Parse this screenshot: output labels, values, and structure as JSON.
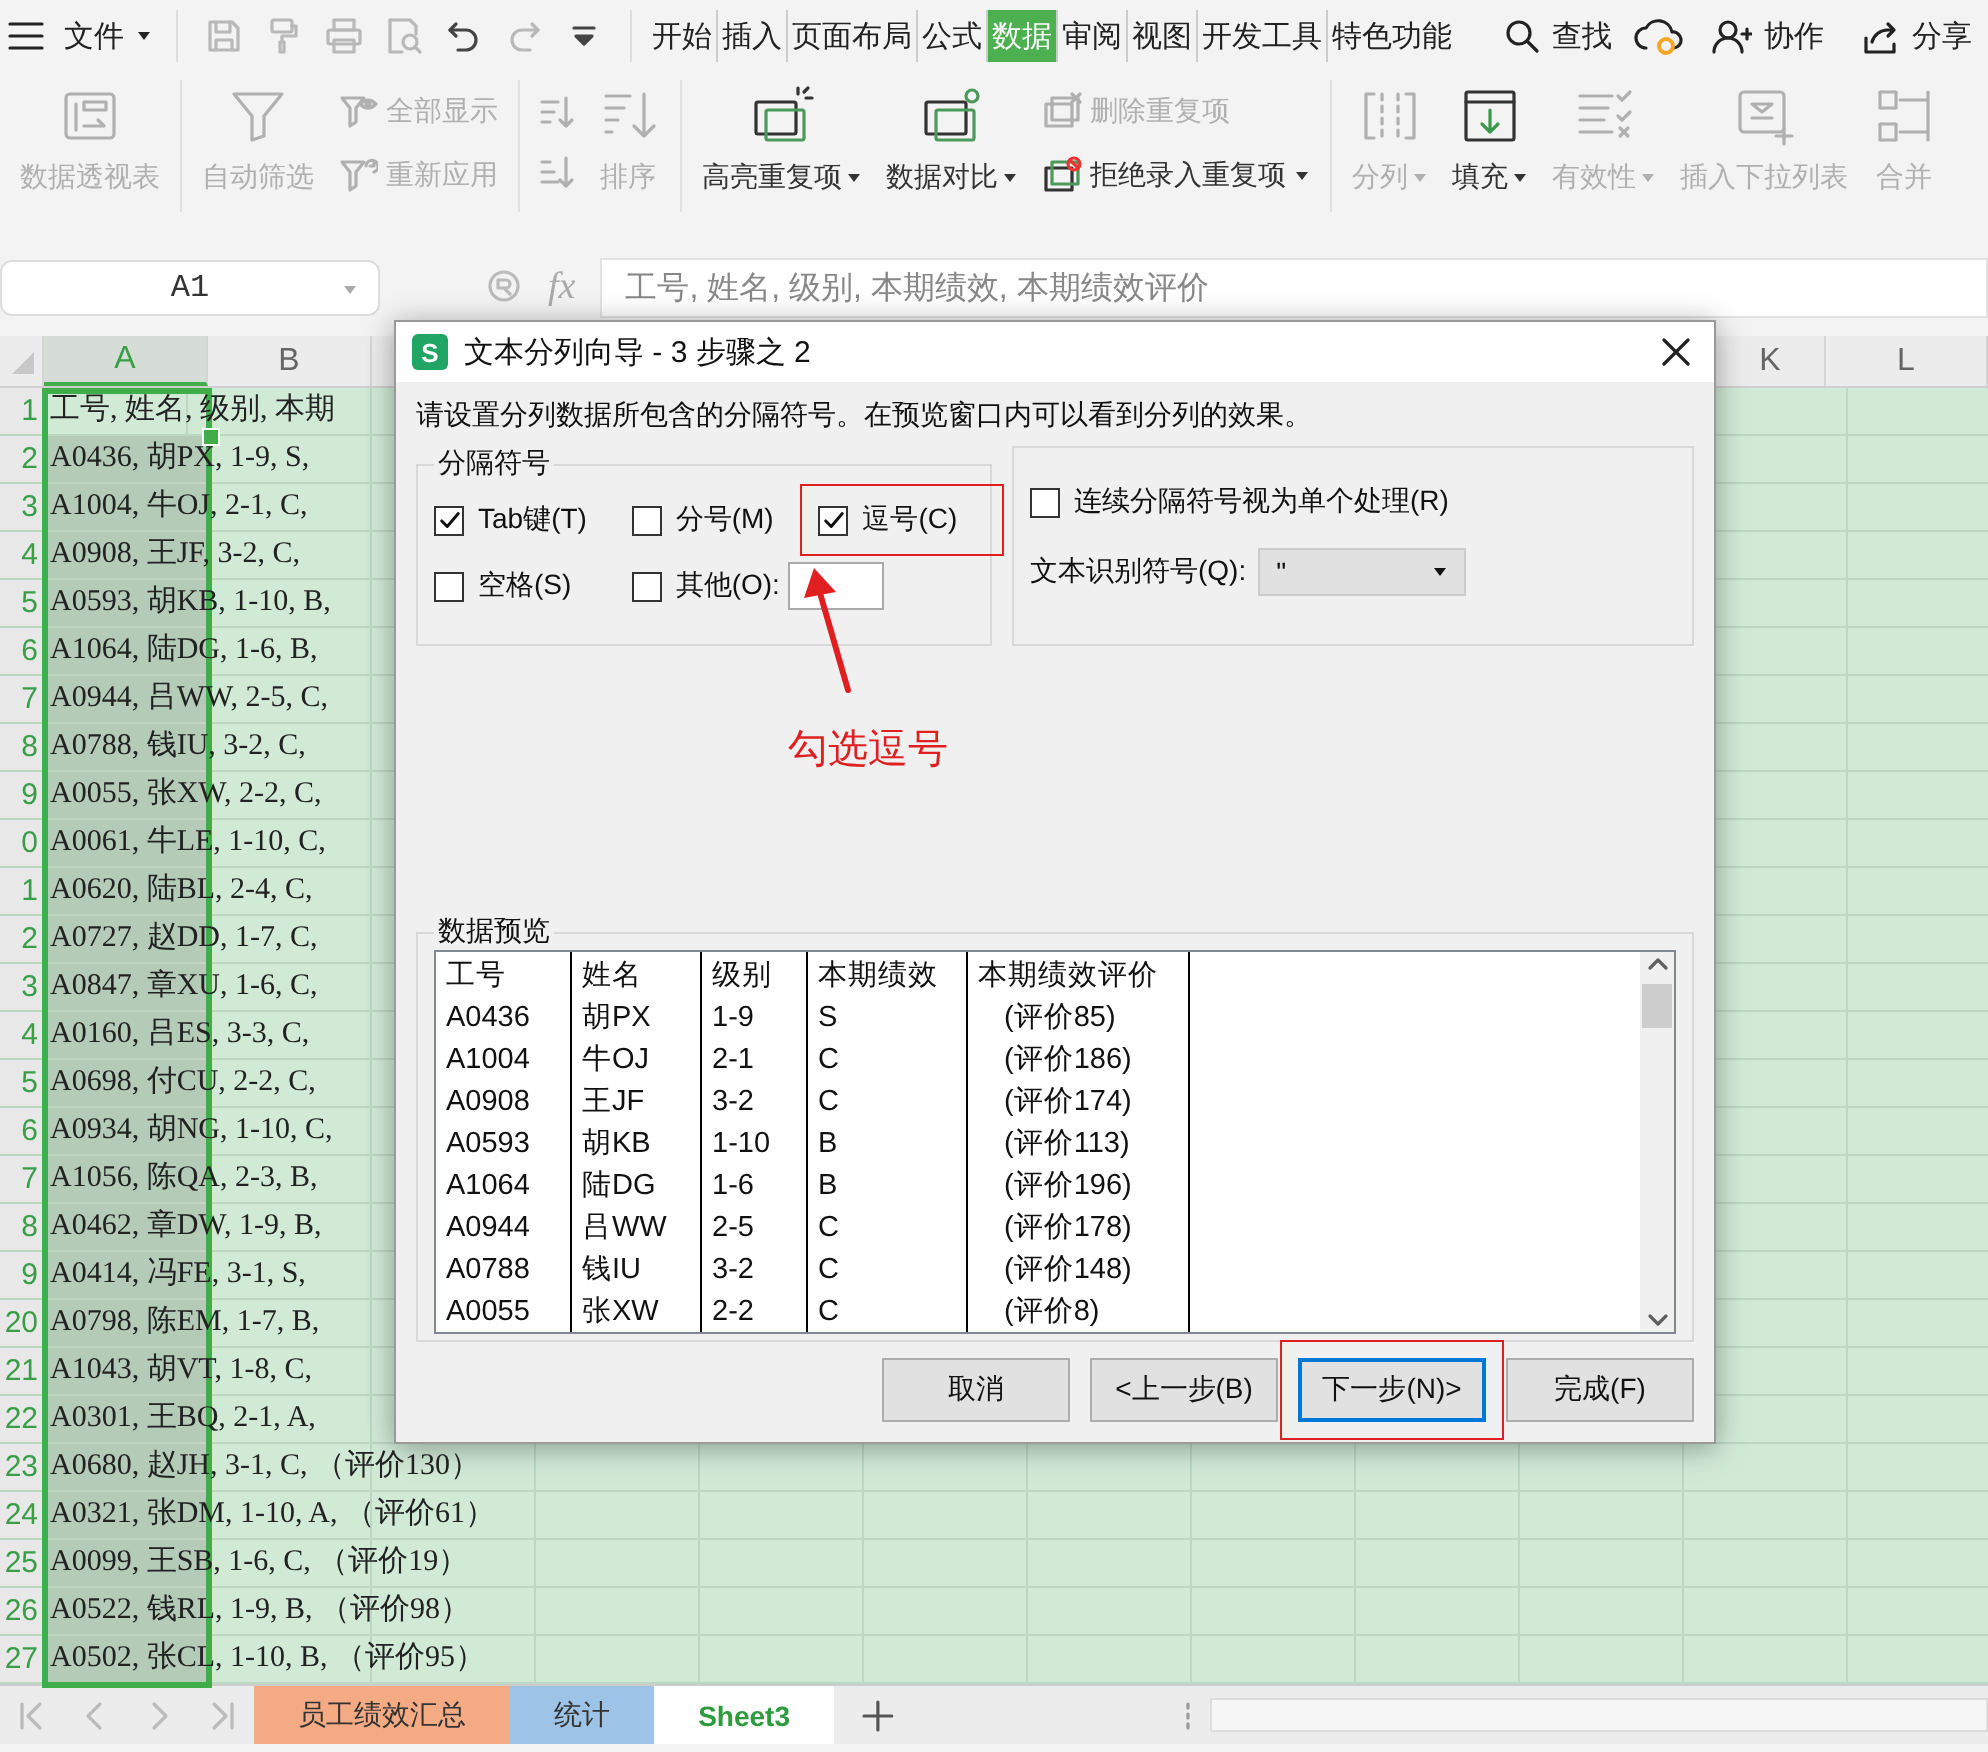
{
  "file_menu": {
    "label": "文件"
  },
  "quick_access": [
    {
      "disabled": true
    },
    {
      "disabled": true
    },
    {
      "disabled": true
    },
    {
      "disabled": true
    },
    {
      "disabled": false
    },
    {
      "disabled": true
    },
    {
      "disabled": false
    }
  ],
  "tabs": [
    {
      "label": "开始",
      "selected": false
    },
    {
      "label": "插入",
      "selected": false
    },
    {
      "label": "页面布局",
      "selected": false
    },
    {
      "label": "公式",
      "selected": false
    },
    {
      "label": "数据",
      "selected": true
    },
    {
      "label": "审阅",
      "selected": false
    },
    {
      "label": "视图",
      "selected": false
    },
    {
      "label": "开发工具",
      "selected": false
    },
    {
      "label": "特色功能",
      "selected": false
    }
  ],
  "search": {
    "label": "查找"
  },
  "actions": [
    {
      "label": "协作"
    },
    {
      "label": "分享"
    }
  ],
  "ribbon_groups": [
    [
      {
        "kind": "large",
        "label": "数据透视表",
        "disabled": true,
        "dropdown": false
      }
    ],
    [
      {
        "kind": "large",
        "label": "自动筛选",
        "disabled": true,
        "dropdown": false
      },
      {
        "kind": "stack",
        "items": [
          {
            "label": "全部显示",
            "disabled": true,
            "dropdown": false
          },
          {
            "label": "重新应用",
            "disabled": true,
            "dropdown": false
          }
        ]
      }
    ],
    [
      {
        "kind": "icons",
        "disabled": true
      },
      {
        "kind": "large",
        "label": "排序",
        "disabled": true,
        "dropdown": false
      }
    ],
    [
      {
        "kind": "large",
        "label": "高亮重复项",
        "disabled": false,
        "dropdown": true
      },
      {
        "kind": "large",
        "label": "数据对比",
        "disabled": false,
        "dropdown": true
      },
      {
        "kind": "stack",
        "items": [
          {
            "label": "删除重复项",
            "disabled": true,
            "dropdown": false
          },
          {
            "label": "拒绝录入重复项",
            "disabled": false,
            "dropdown": true
          }
        ]
      }
    ],
    [
      {
        "kind": "large",
        "label": "分列",
        "disabled": true,
        "dropdown": true
      },
      {
        "kind": "large",
        "label": "填充",
        "disabled": false,
        "dropdown": true
      },
      {
        "kind": "large",
        "label": "有效性",
        "disabled": true,
        "dropdown": true
      },
      {
        "kind": "large",
        "label": "插入下拉列表",
        "disabled": true,
        "dropdown": false
      },
      {
        "kind": "large",
        "label": "合并",
        "disabled": true,
        "dropdown": false
      }
    ]
  ],
  "formula_bar": {
    "cell": "A1",
    "fx": "fx",
    "formula": "工号, 姓名, 级别, 本期绩效, 本期绩效评价"
  },
  "sheet": {
    "left_columns": [
      {
        "label": "A",
        "selected": true
      },
      {
        "label": "B",
        "selected": false
      }
    ],
    "right_columns": [
      {
        "label": "K",
        "selected": false
      },
      {
        "label": "L",
        "selected": false
      }
    ],
    "rows": [
      {
        "number": "1",
        "text": "工号, 姓名, 级别, 本期"
      },
      {
        "number": "2",
        "text": "A0436, 胡PX, 1-9, S,"
      },
      {
        "number": "3",
        "text": "A1004, 牛OJ, 2-1, C,"
      },
      {
        "number": "4",
        "text": "A0908, 王JF, 3-2, C,"
      },
      {
        "number": "5",
        "text": "A0593, 胡KB, 1-10, B,"
      },
      {
        "number": "6",
        "text": "A1064, 陆DG, 1-6, B,"
      },
      {
        "number": "7",
        "text": "A0944, 吕WW, 2-5, C,"
      },
      {
        "number": "8",
        "text": "A0788, 钱IU, 3-2, C,"
      },
      {
        "number": "9",
        "text": "A0055, 张XW, 2-2, C,"
      },
      {
        "number": "0",
        "text": "A0061, 牛LE, 1-10, C,"
      },
      {
        "number": "1",
        "text": "A0620, 陆BL, 2-4, C,"
      },
      {
        "number": "2",
        "text": "A0727, 赵DD, 1-7, C,"
      },
      {
        "number": "3",
        "text": "A0847, 章XU, 1-6, C,"
      },
      {
        "number": "4",
        "text": "A0160, 吕ES, 3-3, C,"
      },
      {
        "number": "5",
        "text": "A0698, 付CU, 2-2, C,"
      },
      {
        "number": "6",
        "text": "A0934, 胡NG, 1-10, C,"
      },
      {
        "number": "7",
        "text": "A1056, 陈QA, 2-3, B,"
      },
      {
        "number": "8",
        "text": "A0462, 章DW, 1-9, B,"
      },
      {
        "number": "9",
        "text": "A0414, 冯FE, 3-1, S,"
      },
      {
        "number": "20",
        "text": "A0798, 陈EM, 1-7, B,"
      },
      {
        "number": "21",
        "text": "A1043, 胡VT, 1-8, C,"
      },
      {
        "number": "22",
        "text": "A0301, 王BQ, 2-1, A,"
      },
      {
        "number": "23",
        "text": "A0680, 赵JH, 3-1, C, （评价130）"
      },
      {
        "number": "24",
        "text": "A0321, 张DM, 1-10, A, （评价61）"
      },
      {
        "number": "25",
        "text": "A0099, 王SB, 1-6, C, （评价19）"
      },
      {
        "number": "26",
        "text": "A0522, 钱RL, 1-9, B, （评价98）"
      },
      {
        "number": "27",
        "text": "A0502, 张CL, 1-10, B, （评价95）"
      }
    ]
  },
  "sheet_tabs": [
    {
      "label": "员工绩效汇总",
      "color": "#f4ab84",
      "selected": false
    },
    {
      "label": "统计",
      "color": "#9dc3e6",
      "selected": false
    },
    {
      "label": "Sheet3",
      "selected": true
    }
  ],
  "dialog": {
    "badge": "S",
    "title": "文本分列向导 - 3 步骤之 2",
    "instruction": "请设置分列数据所包含的分隔符号。在预览窗口内可以看到分列的效果。",
    "delimiters": {
      "title": "分隔符号",
      "options": [
        {
          "label": "Tab键(T)",
          "checked": true,
          "highlighted": false
        },
        {
          "label": "分号(M)",
          "checked": false,
          "highlighted": false
        },
        {
          "label": "逗号(C)",
          "checked": true,
          "highlighted": true
        },
        {
          "label": "空格(S)",
          "checked": false,
          "highlighted": false
        },
        {
          "label": "其他(O):",
          "checked": false,
          "highlighted": false
        }
      ]
    },
    "consecutive": {
      "label": "连续分隔符号视为单个处理(R)",
      "checked": false
    },
    "qualifier": {
      "label": "文本识别符号(Q):",
      "value": "\""
    },
    "preview": {
      "title": "数据预览",
      "columns": [
        "工号",
        "姓名",
        "级别",
        "本期绩效",
        "本期绩效评价"
      ],
      "rows": [
        [
          "A0436",
          "胡PX",
          "1-9",
          "S",
          "(评价85)"
        ],
        [
          "A1004",
          "牛OJ",
          "2-1",
          "C",
          "(评价186)"
        ],
        [
          "A0908",
          "王JF",
          "3-2",
          "C",
          "(评价174)"
        ],
        [
          "A0593",
          "胡KB",
          "1-10",
          "B",
          "(评价113)"
        ],
        [
          "A1064",
          "陆DG",
          "1-6",
          "B",
          "(评价196)"
        ],
        [
          "A0944",
          "吕WW",
          "2-5",
          "C",
          "(评价178)"
        ],
        [
          "A0788",
          "钱IU",
          "3-2",
          "C",
          "(评价148)"
        ],
        [
          "A0055",
          "张XW",
          "2-2",
          "C",
          "(评价8)"
        ]
      ]
    },
    "buttons": [
      {
        "label": "取消",
        "focused": false,
        "highlighted": false
      },
      {
        "label": "<上一步(B)",
        "focused": false,
        "highlighted": false
      },
      {
        "label": "下一步(N)>",
        "focused": true,
        "highlighted": true
      },
      {
        "label": "完成(F)",
        "focused": false,
        "highlighted": false
      }
    ]
  },
  "callout": {
    "text": "勾选逗号"
  }
}
